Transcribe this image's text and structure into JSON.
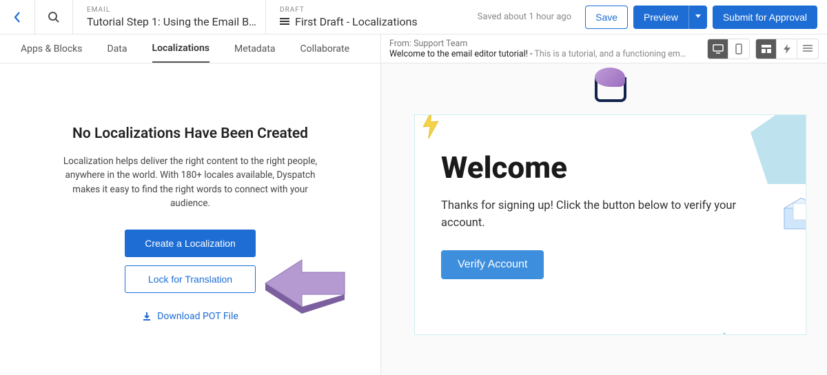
{
  "header": {
    "crumb1_label": "EMAIL",
    "crumb1_title": "Tutorial Step 1: Using the Email B…",
    "crumb2_label": "DRAFT",
    "crumb2_title": "First Draft - Localizations",
    "saved": "Saved about 1 hour ago",
    "save_btn": "Save",
    "preview_btn": "Preview",
    "submit_btn": "Submit for Approval"
  },
  "tabs": {
    "apps": "Apps & Blocks",
    "data": "Data",
    "localizations": "Localizations",
    "metadata": "Metadata",
    "collaborate": "Collaborate"
  },
  "empty": {
    "title": "No Localizations Have Been Created",
    "desc": "Localization helps deliver the right content to the right people, anywhere in the world. With 180+ locales available, Dyspatch makes it easy to find the right words to connect with your audience.",
    "create": "Create a Localization",
    "lock": "Lock for Translation",
    "download": "Download POT File"
  },
  "preview": {
    "from_label": "From: ",
    "from": "Support Team",
    "subject_bold": "Welcome to the email editor tutorial! - ",
    "subject_rest": "This is a tutorial, and a functioning em…"
  },
  "email": {
    "heading": "Welcome",
    "body": "Thanks for signing up! Click the button below to verify your account.",
    "verify": "Verify Account"
  }
}
